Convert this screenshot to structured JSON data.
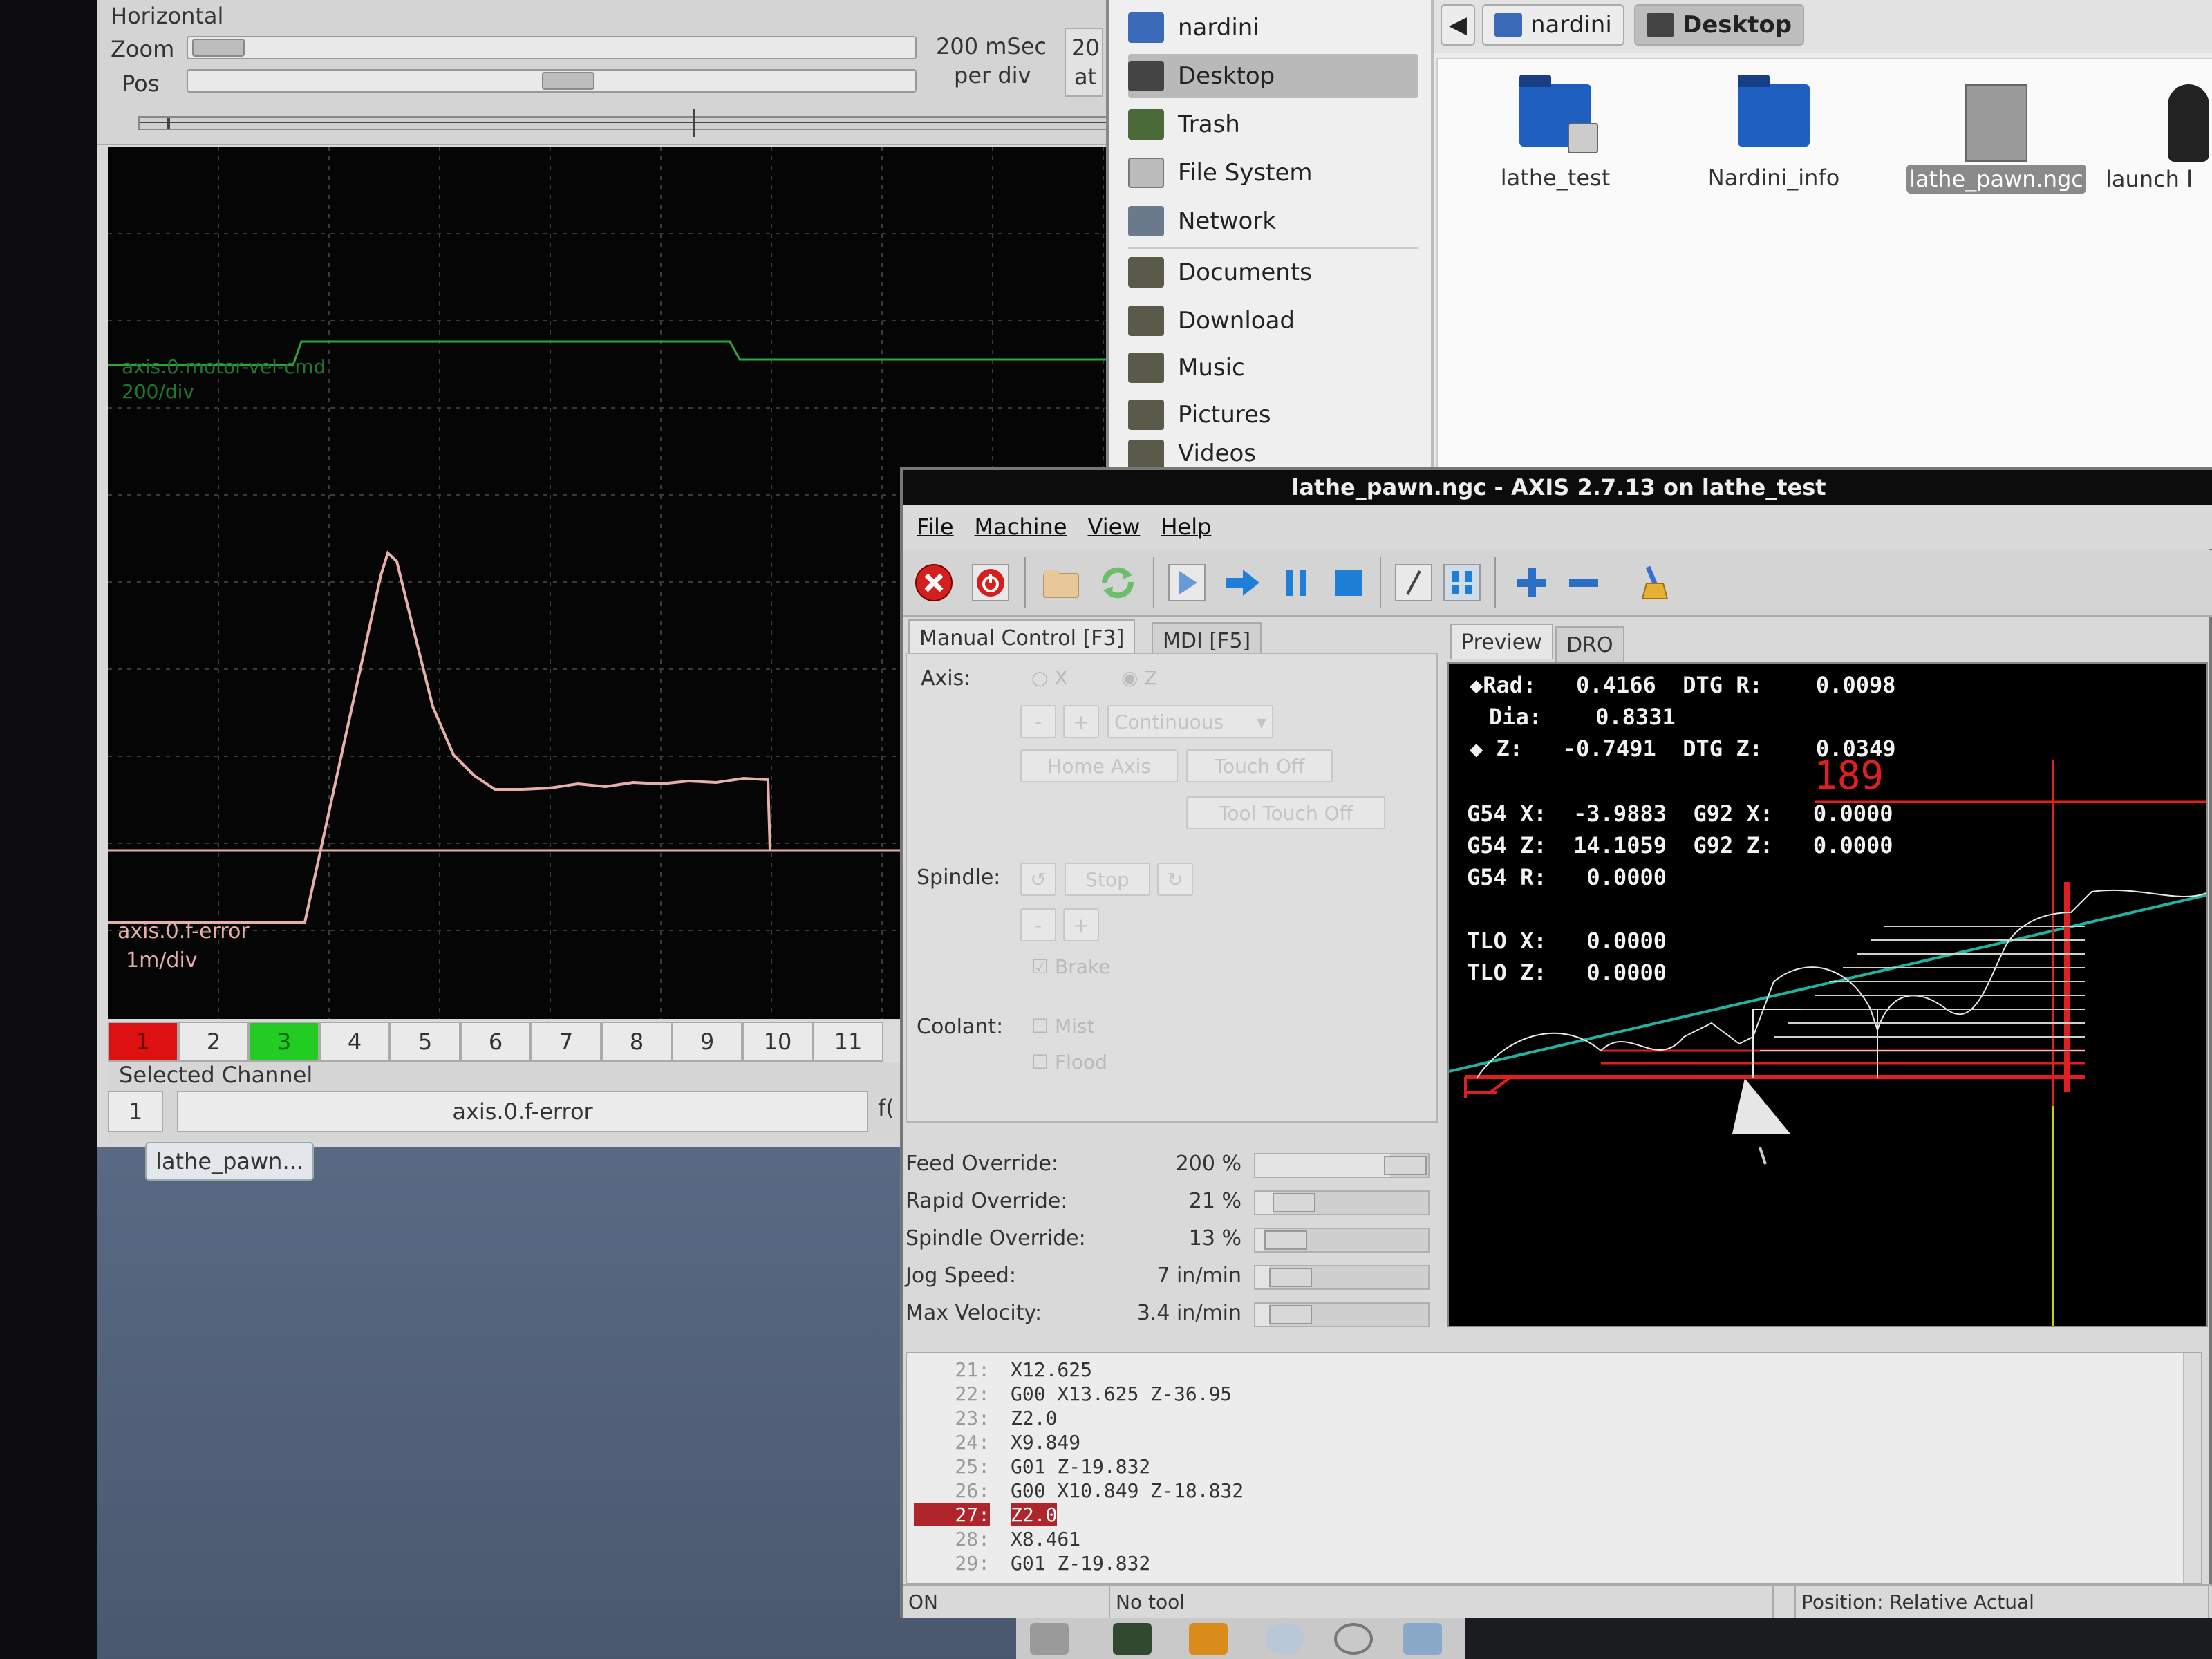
{
  "colors": {
    "scope_trace": "#e6b0a8",
    "scope_trace2": "#2aa63a",
    "preview_bg": "#000000",
    "red_line": "#e02020",
    "teal_line": "#1fb3a0",
    "highlight": "#b0242b"
  },
  "halscope": {
    "horizontal_label": "Horizontal",
    "zoom_label": "Zoom",
    "pos_label": "Pos",
    "time_per_div": "200 mSec",
    "per_div_label": "per div",
    "rate_value": "20",
    "rate_at": "at",
    "channel1_label": "axis.0.f-error",
    "channel1_scale": "1m/div",
    "channel3_label": "axis.0.motor-vel-cmd",
    "channel3_scale": "200/div",
    "channels": [
      "1",
      "2",
      "3",
      "4",
      "5",
      "6",
      "7",
      "8",
      "9",
      "10",
      "11"
    ],
    "selected_channel_label": "Selected Channel",
    "selected_channel_num": "1",
    "selected_channel_name": "axis.0.f-error",
    "selected_channel_extra": "f("
  },
  "taskbar_button": "lathe_pawn...",
  "file_manager": {
    "places": [
      {
        "label": "nardini",
        "icon": "home-folder-icon"
      },
      {
        "label": "Desktop",
        "icon": "desktop-icon"
      },
      {
        "label": "Trash",
        "icon": "trash-icon"
      },
      {
        "label": "File System",
        "icon": "drive-icon"
      },
      {
        "label": "Network",
        "icon": "network-icon"
      },
      {
        "label": "Documents",
        "icon": "folder-icon"
      },
      {
        "label": "Download",
        "icon": "folder-icon"
      },
      {
        "label": "Music",
        "icon": "folder-icon"
      },
      {
        "label": "Pictures",
        "icon": "folder-icon"
      },
      {
        "label": "Videos",
        "icon": "folder-icon"
      }
    ],
    "path": [
      "nardini",
      "Desktop"
    ],
    "files": [
      {
        "label": "lathe_test",
        "icon": "folder-link-icon"
      },
      {
        "label": "Nardini_info",
        "icon": "folder-icon"
      },
      {
        "label": "lathe_pawn.ngc",
        "icon": "text-file-icon"
      },
      {
        "label": "launch l",
        "icon": "penguin-launcher-icon"
      }
    ]
  },
  "axis": {
    "title": "lathe_pawn.ngc - AXIS 2.7.13 on lathe_test",
    "menu": [
      "File",
      "Machine",
      "View",
      "Help"
    ],
    "tabs_left": [
      "Manual Control [F3]",
      "MDI [F5]"
    ],
    "tabs_right": [
      "Preview",
      "DRO"
    ],
    "manual": {
      "axis_label": "Axis:",
      "axis_x": "X",
      "axis_z": "Z",
      "jog_minus": "-",
      "jog_plus": "+",
      "jog_mode": "Continuous",
      "home_axis": "Home Axis",
      "touch_off": "Touch Off",
      "tool_touch_off": "Tool Touch Off",
      "spindle_label": "Spindle:",
      "spindle_stop": "Stop",
      "spindle_minus": "-",
      "spindle_plus": "+",
      "brake": "Brake",
      "coolant_label": "Coolant:",
      "mist": "Mist",
      "flood": "Flood"
    },
    "overrides": [
      {
        "label": "Feed Override:",
        "value": "200 %",
        "fraction": 0.78
      },
      {
        "label": "Rapid Override:",
        "value": "21 %",
        "fraction": 0.1
      },
      {
        "label": "Spindle Override:",
        "value": "13 %",
        "fraction": 0.05
      },
      {
        "label": "Jog Speed:",
        "value": "7 in/min",
        "fraction": 0.08
      },
      {
        "label": "Max Velocity:",
        "value": "3.4 in/min",
        "fraction": 0.08
      }
    ],
    "dro": [
      {
        "name": "Rad:",
        "value": "0.4166",
        "name2": "DTG R:",
        "value2": "0.0098"
      },
      {
        "name": "Dia:",
        "value": "0.8331",
        "name2": "",
        "value2": ""
      },
      {
        "name": "Z:",
        "value": "-0.7491",
        "name2": "DTG Z:",
        "value2": "0.0349"
      },
      {
        "name": "G54 X:",
        "value": "-3.9883",
        "name2": "G92 X:",
        "value2": "0.0000"
      },
      {
        "name": "G54 Z:",
        "value": "14.1059",
        "name2": "G92 Z:",
        "value2": "0.0000"
      },
      {
        "name": "G54 R:",
        "value": "0.0000",
        "name2": "",
        "value2": ""
      },
      {
        "name": "TLO X:",
        "value": "0.0000",
        "name2": "",
        "value2": ""
      },
      {
        "name": "TLO Z:",
        "value": "0.0000",
        "name2": "",
        "value2": ""
      }
    ],
    "preview_label": "189",
    "gcode": [
      {
        "n": "21:",
        "code": "X12.625"
      },
      {
        "n": "22:",
        "code": "G00 X13.625 Z-36.95"
      },
      {
        "n": "23:",
        "code": "Z2.0"
      },
      {
        "n": "24:",
        "code": "X9.849"
      },
      {
        "n": "25:",
        "code": "G01 Z-19.832"
      },
      {
        "n": "26:",
        "code": "G00 X10.849 Z-18.832"
      },
      {
        "n": "27:",
        "code": "Z2.0"
      },
      {
        "n": "28:",
        "code": "X8.461"
      },
      {
        "n": "29:",
        "code": "G01 Z-19.832"
      }
    ],
    "current_line_index": 6,
    "status": {
      "state": "ON",
      "tool": "No tool",
      "position": "Position: Relative Actual"
    }
  }
}
